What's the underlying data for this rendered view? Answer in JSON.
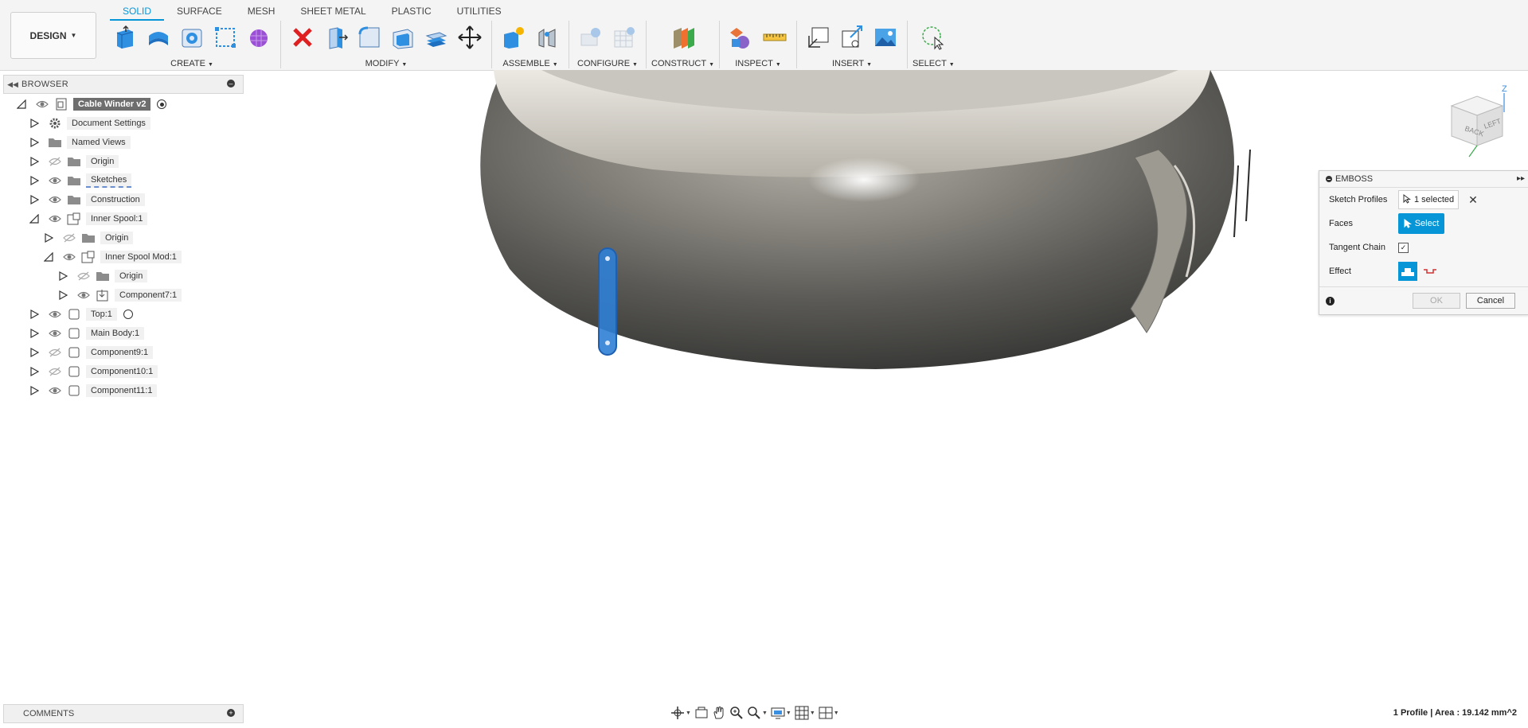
{
  "workspace": {
    "label": "DESIGN"
  },
  "tabs": [
    "SOLID",
    "SURFACE",
    "MESH",
    "SHEET METAL",
    "PLASTIC",
    "UTILITIES"
  ],
  "active_tab": "SOLID",
  "toolbar_groups": [
    {
      "label": "CREATE",
      "icons": [
        "new-component-icon",
        "extrude-icon",
        "revolve-icon",
        "hole-icon",
        "pattern-icon",
        "form-icon"
      ]
    },
    {
      "label": "MODIFY",
      "icons": [
        "delete-icon",
        "press-pull-icon",
        "fillet-icon",
        "shell-icon",
        "combine-icon",
        "move-icon"
      ]
    },
    {
      "label": "ASSEMBLE",
      "icons": [
        "new-component-assemble-icon",
        "joint-icon"
      ]
    },
    {
      "label": "CONFIGURE",
      "icons": [
        "configure-icon",
        "configure-table-icon"
      ]
    },
    {
      "label": "CONSTRUCT",
      "icons": [
        "offset-plane-icon"
      ]
    },
    {
      "label": "INSPECT",
      "icons": [
        "interference-icon",
        "measure-icon"
      ]
    },
    {
      "label": "INSERT",
      "icons": [
        "insert-derive-icon",
        "insert-link-icon",
        "insert-image-icon"
      ]
    },
    {
      "label": "SELECT",
      "icons": [
        "window-select-icon"
      ]
    }
  ],
  "browser": {
    "title": "BROWSER",
    "items": [
      {
        "label": "Cable Winder v2",
        "level": 0,
        "expanded": true,
        "selected": true,
        "icon": "document-icon",
        "eye": "visible",
        "radio": "filled"
      },
      {
        "label": "Document Settings",
        "level": 1,
        "icon": "gear-icon"
      },
      {
        "label": "Named Views",
        "level": 1,
        "icon": "folder-icon"
      },
      {
        "label": "Origin",
        "level": 1,
        "icon": "folder-icon",
        "eye": "hidden"
      },
      {
        "label": "Sketches",
        "level": 1,
        "icon": "folder-icon",
        "eye": "visible"
      },
      {
        "label": "Construction",
        "level": 1,
        "icon": "folder-icon",
        "eye": "visible"
      },
      {
        "label": "Inner Spool:1",
        "level": 1,
        "expanded": true,
        "icon": "component-link-icon",
        "eye": "visible"
      },
      {
        "label": "Origin",
        "level": 2,
        "icon": "folder-icon",
        "eye": "hidden"
      },
      {
        "label": "Inner Spool Mod:1",
        "level": 2,
        "expanded": true,
        "icon": "component-link-icon",
        "eye": "visible"
      },
      {
        "label": "Origin",
        "level": 3,
        "icon": "folder-icon",
        "eye": "hidden"
      },
      {
        "label": "Component7:1",
        "level": 3,
        "icon": "component-joint-icon",
        "eye": "visible"
      },
      {
        "label": "Top:1",
        "level": 1,
        "icon": "component-icon",
        "eye": "visible",
        "radio": "empty"
      },
      {
        "label": "Main Body:1",
        "level": 1,
        "icon": "component-icon",
        "eye": "visible"
      },
      {
        "label": "Component9:1",
        "level": 1,
        "icon": "component-icon",
        "eye": "hidden"
      },
      {
        "label": "Component10:1",
        "level": 1,
        "icon": "component-icon",
        "eye": "hidden"
      },
      {
        "label": "Component11:1",
        "level": 1,
        "icon": "component-icon",
        "eye": "visible"
      }
    ]
  },
  "viewcube": {
    "faces": [
      "BACK",
      "LEFT"
    ],
    "axis": "Z"
  },
  "emboss_dialog": {
    "title": "EMBOSS",
    "rows": {
      "sketch_profiles": {
        "label": "Sketch Profiles",
        "value": "1 selected"
      },
      "faces": {
        "label": "Faces",
        "button": "Select"
      },
      "tangent_chain": {
        "label": "Tangent Chain",
        "checked": true
      },
      "effect": {
        "label": "Effect"
      }
    },
    "ok_label": "OK",
    "cancel_label": "Cancel"
  },
  "comments": {
    "title": "COMMENTS"
  },
  "nav_bar": [
    "orbit-icon",
    "look-at-icon",
    "pan-icon",
    "zoom-icon",
    "zoom-window-icon",
    "display-settings-icon",
    "grid-icon",
    "viewports-icon"
  ],
  "status": {
    "text": "1 Profile | Area : 19.142 mm^2"
  },
  "colors": {
    "accent": "#0696d7",
    "profile_highlight": "#2f7fd6",
    "body_gray": "#6b6a66"
  }
}
